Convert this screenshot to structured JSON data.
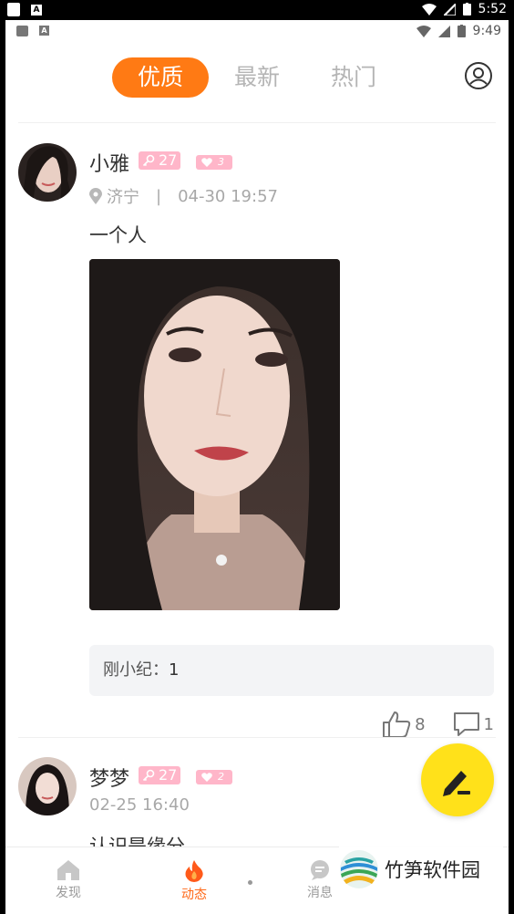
{
  "outer_status": {
    "time": "5:52"
  },
  "inner_status": {
    "time": "9:49"
  },
  "tabs": [
    {
      "label": "优质",
      "active": true
    },
    {
      "label": "最新",
      "active": false
    },
    {
      "label": "热门",
      "active": false
    }
  ],
  "posts": [
    {
      "username": "小雅",
      "level": "27",
      "hearts": "3",
      "location": "济宁",
      "separator": "|",
      "time": "04-30 19:57",
      "text": "一个人",
      "comment_label": "刚小纪：",
      "comment_value": "1",
      "likes": "8",
      "comments": "1"
    },
    {
      "username": "梦梦",
      "level": "27",
      "hearts": "2",
      "time": "02-25 16:40",
      "text": "认识是缘分"
    }
  ],
  "nav": {
    "items": [
      {
        "label": "发现",
        "icon": "home-icon"
      },
      {
        "label": "动态",
        "icon": "flame-icon",
        "active": true
      },
      {
        "label": "消息",
        "icon": "message-icon"
      }
    ]
  },
  "watermark": {
    "text": "竹笋软件园"
  },
  "colors": {
    "accent": "#ff7a14",
    "badge": "#ffb6c9",
    "fab": "#ffe11a"
  }
}
